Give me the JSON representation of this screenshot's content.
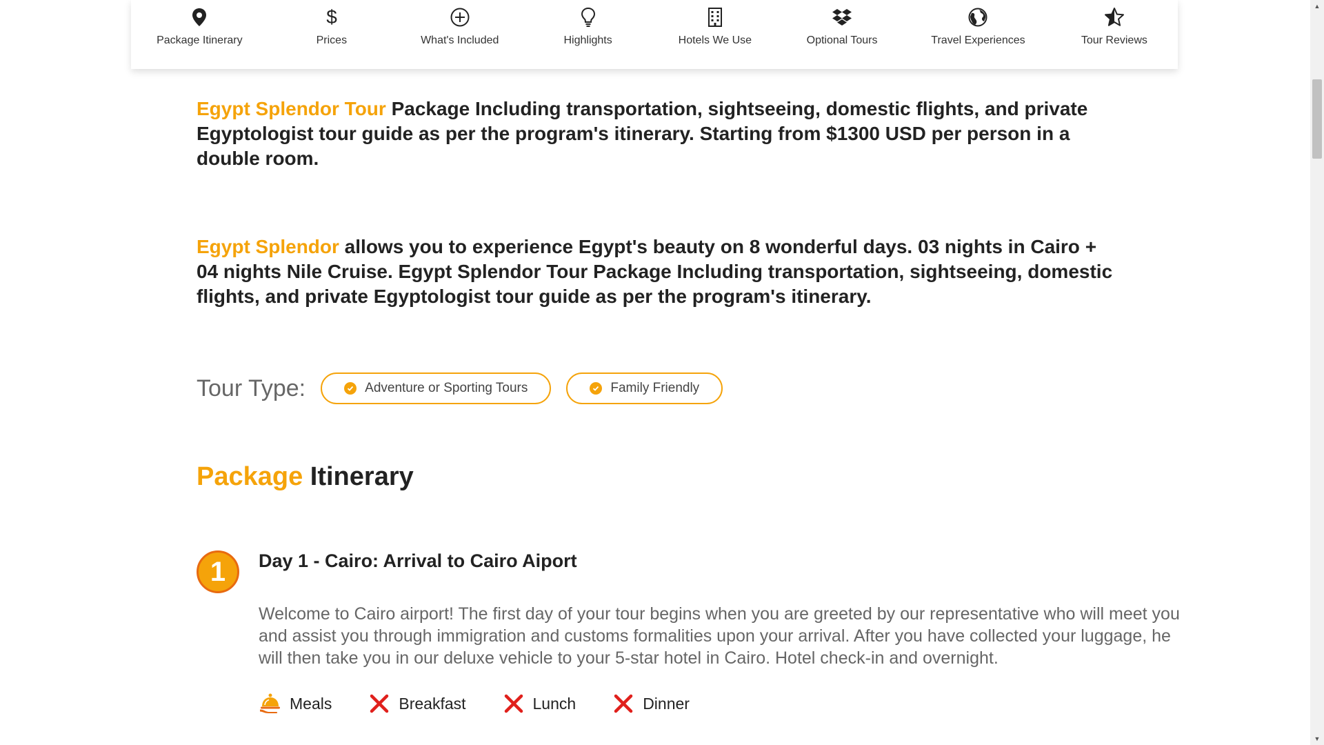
{
  "nav": {
    "items": [
      {
        "label": "Package Itinerary",
        "icon": "map-pin-icon"
      },
      {
        "label": "Prices",
        "icon": "dollar-icon"
      },
      {
        "label": "What's Included",
        "icon": "plus-circle-icon"
      },
      {
        "label": "Highlights",
        "icon": "lightbulb-icon"
      },
      {
        "label": "Hotels We Use",
        "icon": "building-icon"
      },
      {
        "label": "Optional Tours",
        "icon": "dropbox-icon"
      },
      {
        "label": "Travel Experiences",
        "icon": "globe-icon"
      },
      {
        "label": "Tour Reviews",
        "icon": "star-half-icon"
      }
    ]
  },
  "intro1": {
    "highlight": "Egypt Splendor Tour",
    "text": " Package Including transportation, sightseeing, domestic flights, and private Egyptologist tour guide as per the program's itinerary. Starting from $1300 USD per person in a double room."
  },
  "intro2": {
    "highlight": "Egypt Splendor",
    "text": " allows you to experience Egypt's beauty on 8 wonderful days. 03 nights in Cairo + 04 nights Nile Cruise. Egypt Splendor Tour Package Including transportation, sightseeing, domestic flights, and private Egyptologist tour guide as per the program's itinerary."
  },
  "tour_type": {
    "label": "Tour Type:",
    "tags": [
      "Adventure or Sporting Tours",
      "Family Friendly"
    ]
  },
  "itinerary": {
    "title_highlight": "Package",
    "title_rest": " Itinerary",
    "days": [
      {
        "number": "1",
        "title": "Day 1 - Cairo: Arrival to Cairo Aiport",
        "description": "Welcome to Cairo airport! The first day of your tour begins when you are greeted by our representative who will meet you and assist you through immigration and customs formalities upon your arrival. After you have collected your luggage, he will then take you in our deluxe vehicle to your 5-star hotel in Cairo. Hotel check-in and overnight.",
        "meals_label": "Meals",
        "meals": [
          {
            "label": "Breakfast",
            "included": false
          },
          {
            "label": "Lunch",
            "included": false
          },
          {
            "label": "Dinner",
            "included": false
          }
        ]
      }
    ]
  },
  "colors": {
    "accent": "#f5a30a",
    "badge_border": "#e86a10",
    "not_included": "#e0201c",
    "body_text": "#222222",
    "muted_text": "#666666"
  }
}
